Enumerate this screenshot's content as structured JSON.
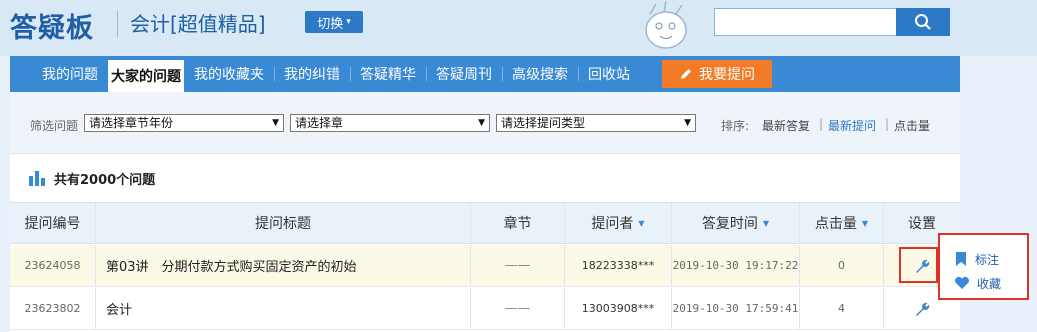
{
  "header": {
    "logo": "答疑板",
    "subject": "会计[超值精品]",
    "switch_label": "切换",
    "search_value": ""
  },
  "nav": {
    "items": [
      "我的问题",
      "大家的问题",
      "我的收藏夹",
      "我的纠错",
      "答疑精华",
      "答疑周刊",
      "高级搜索",
      "回收站"
    ],
    "active_index": 1,
    "ask_label": "我要提问"
  },
  "filters": {
    "label": "筛选问题",
    "year_select": "请选择章节年份",
    "chapter_select": "请选择章",
    "type_select": "请选择提问类型",
    "sort_label": "排序:",
    "sort_options": [
      "最新答复",
      "最新提问",
      "点击量"
    ],
    "sort_active_index": 1
  },
  "summary": {
    "count_text": "共有2000个问题"
  },
  "table": {
    "headers": [
      "提问编号",
      "提问标题",
      "章节",
      "提问者",
      "答复时间",
      "点击量",
      "设置"
    ],
    "rows": [
      {
        "id": "23624058",
        "title": "第03讲　分期付款方式购买固定资产的初始",
        "chapter": "——",
        "author": "18223338***",
        "time": "2019-10-30 19:17:22",
        "clicks": "0",
        "highlight": true
      },
      {
        "id": "23623802",
        "title": "会计",
        "chapter": "——",
        "author": "13003908***",
        "time": "2019-10-30 17:59:41",
        "clicks": "4",
        "highlight": false
      }
    ]
  },
  "popup": {
    "items": [
      "标注",
      "收藏"
    ]
  },
  "colors": {
    "brand_blue": "#3a89d4",
    "accent_orange": "#f47b25",
    "highlight_red": "#e0302a"
  }
}
